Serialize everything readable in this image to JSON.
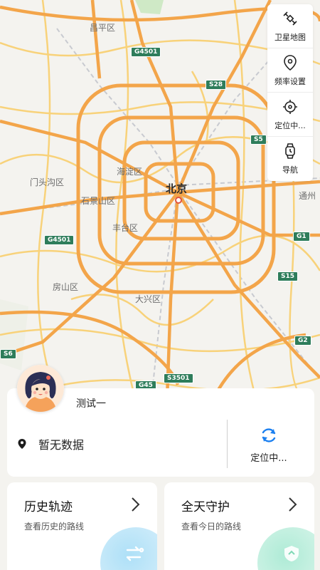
{
  "map": {
    "labels": {
      "changping": "昌平区",
      "haidian": "海淀区",
      "beijing": "北京",
      "mentougou": "门头沟区",
      "shijingshan": "石景山区",
      "fengtai": "丰台区",
      "fangshan": "房山区",
      "daxing": "大兴区",
      "tongzhou": "通州"
    },
    "shields": {
      "g4501_top": "G4501",
      "s28": "S28",
      "s5": "S5",
      "g4501_left": "G4501",
      "g1": "G1",
      "s15": "S15",
      "g2": "G2",
      "s3501": "S3501",
      "g45": "G45",
      "s6": "S6"
    }
  },
  "toolbar": {
    "satellite_label": "卫星地图",
    "frequency_label": "频率设置",
    "locate_label": "定位中...",
    "navigate_label": "导航"
  },
  "device": {
    "name": "测试一",
    "location_text": "暂无数据",
    "locate_button_label": "定位中..."
  },
  "features": {
    "history_title": "历史轨迹",
    "history_sub": "查看历史的路线",
    "guard_title": "全天守护",
    "guard_sub": "查看今日的路线"
  },
  "colors": {
    "accent_blue": "#1a7ff0",
    "road_orange": "#f3a54a",
    "road_yellow": "#f8d27a"
  }
}
